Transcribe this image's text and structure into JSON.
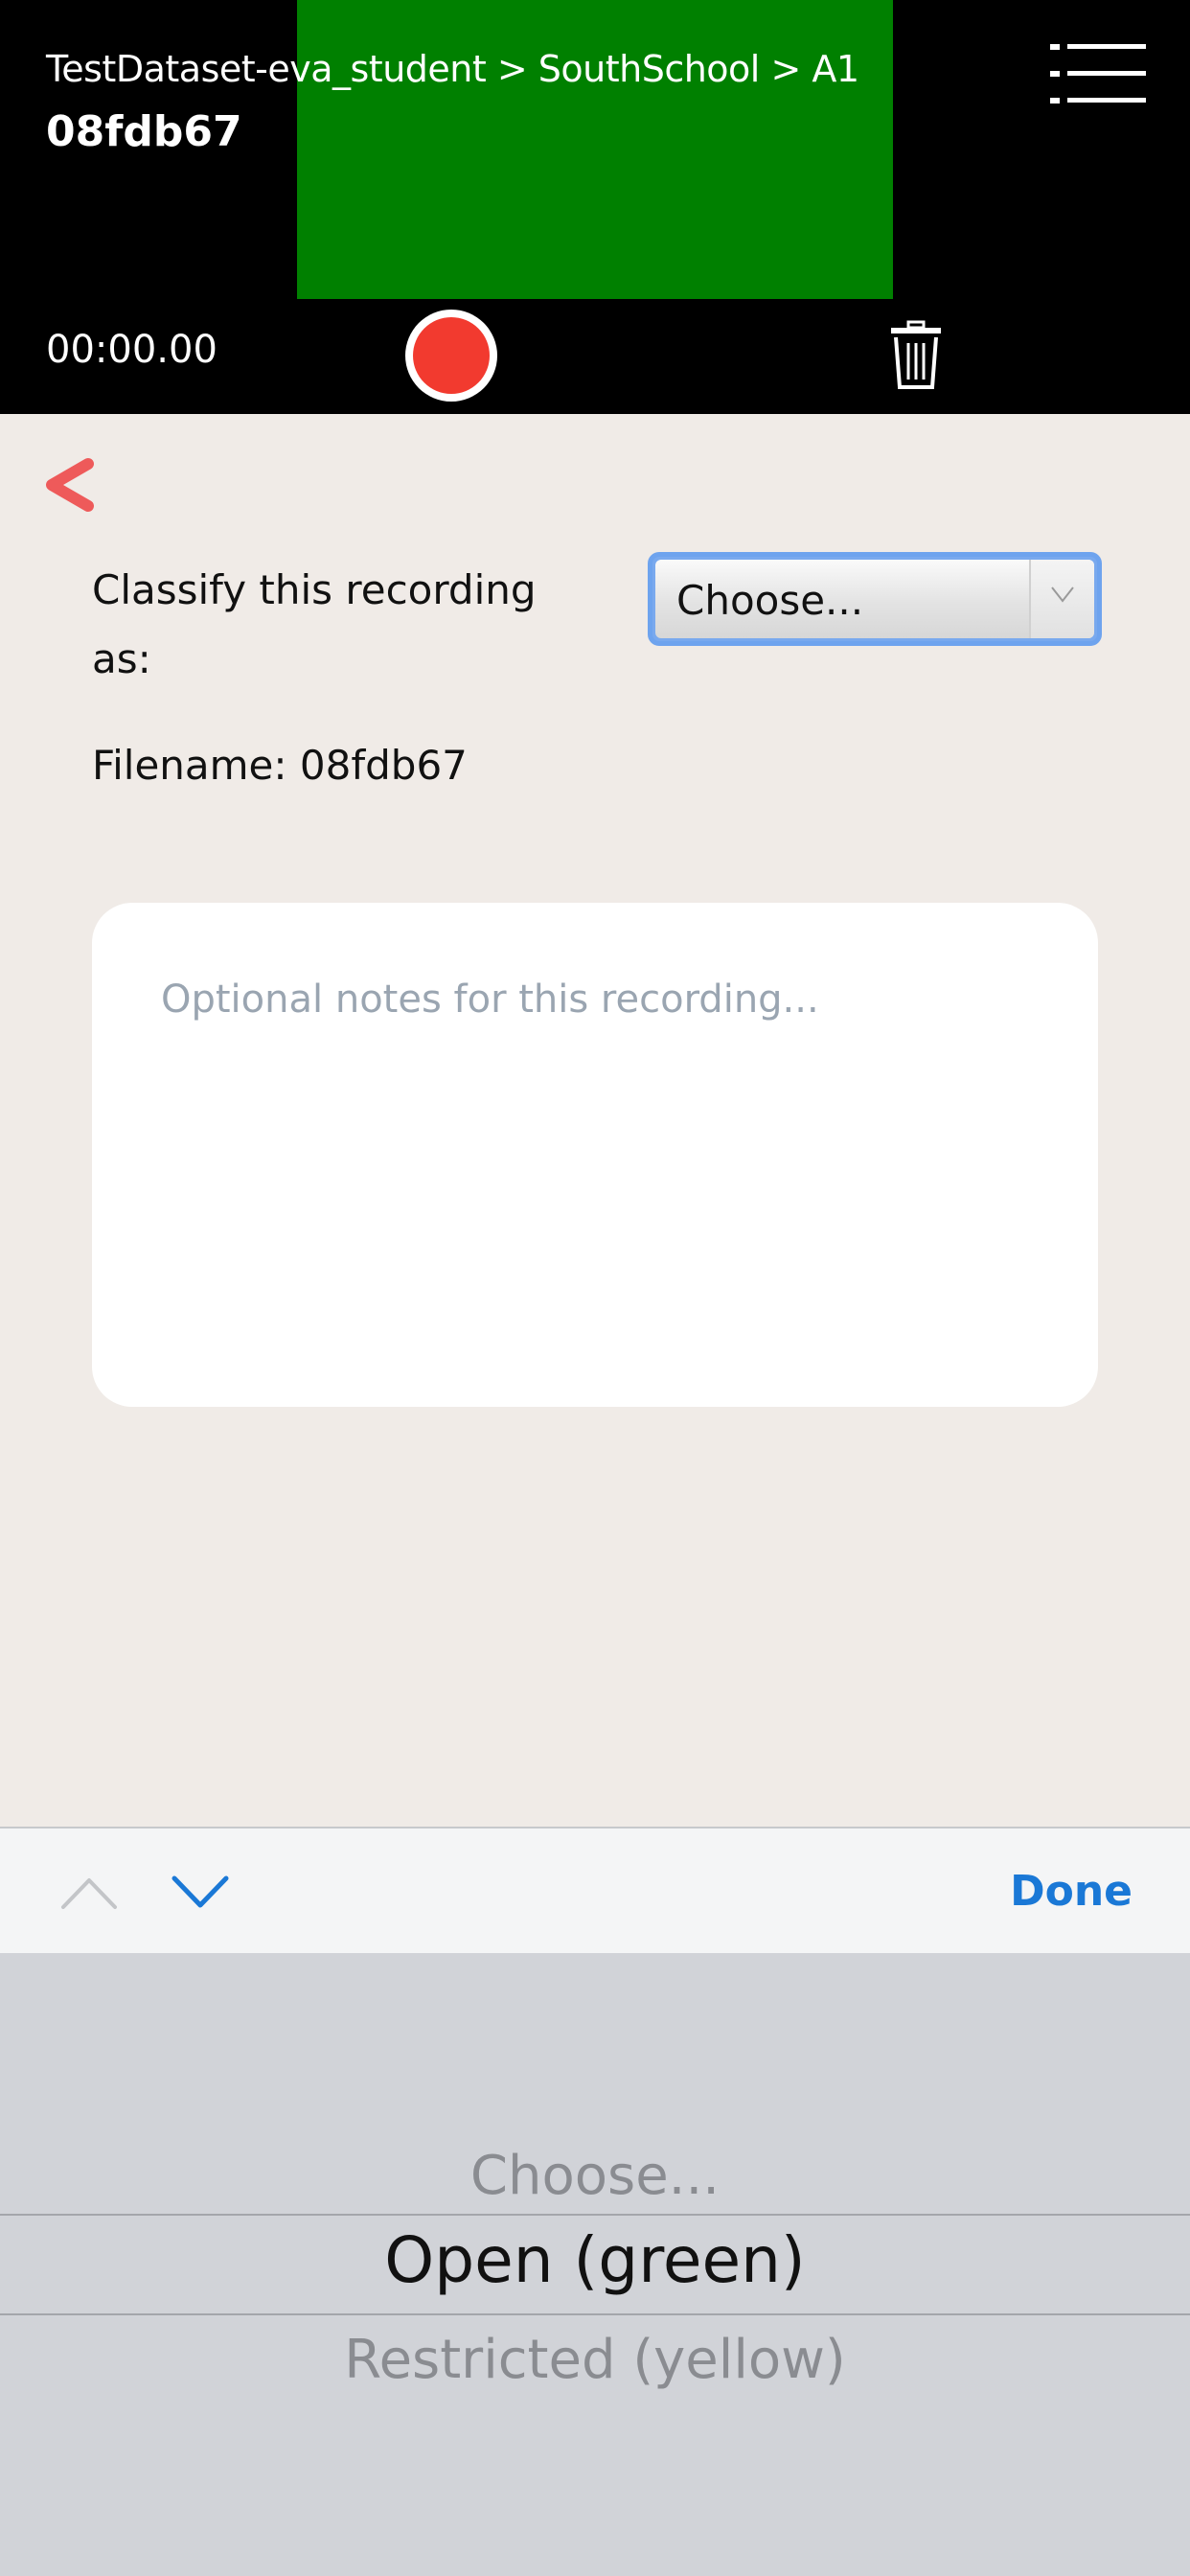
{
  "header": {
    "breadcrumb": "TestDataset-eva_student > SouthSchool > A1",
    "recording_id": "08fdb67",
    "timer": "00:00.00",
    "video_preview_color": "#008000",
    "record_button_color": "#f23a2f",
    "menu_icon": "hamburger-menu-icon",
    "trash_icon": "trash-icon"
  },
  "form": {
    "back_icon": "chevron-left-icon",
    "back_icon_color": "#ee5a5a",
    "classify_label": "Classify this recording as:",
    "classify_selected": "Choose...",
    "filename_label": "Filename: 08fdb67",
    "notes_placeholder": "Optional notes for this recording...",
    "notes_value": ""
  },
  "accessory_bar": {
    "prev_icon": "chevron-up-icon",
    "next_icon": "chevron-down-icon",
    "done_label": "Done",
    "accent_color": "#1a78d6"
  },
  "picker": {
    "options": [
      "Choose...",
      "Open (green)",
      "Restricted (yellow)"
    ],
    "highlighted": "Open (green)"
  }
}
